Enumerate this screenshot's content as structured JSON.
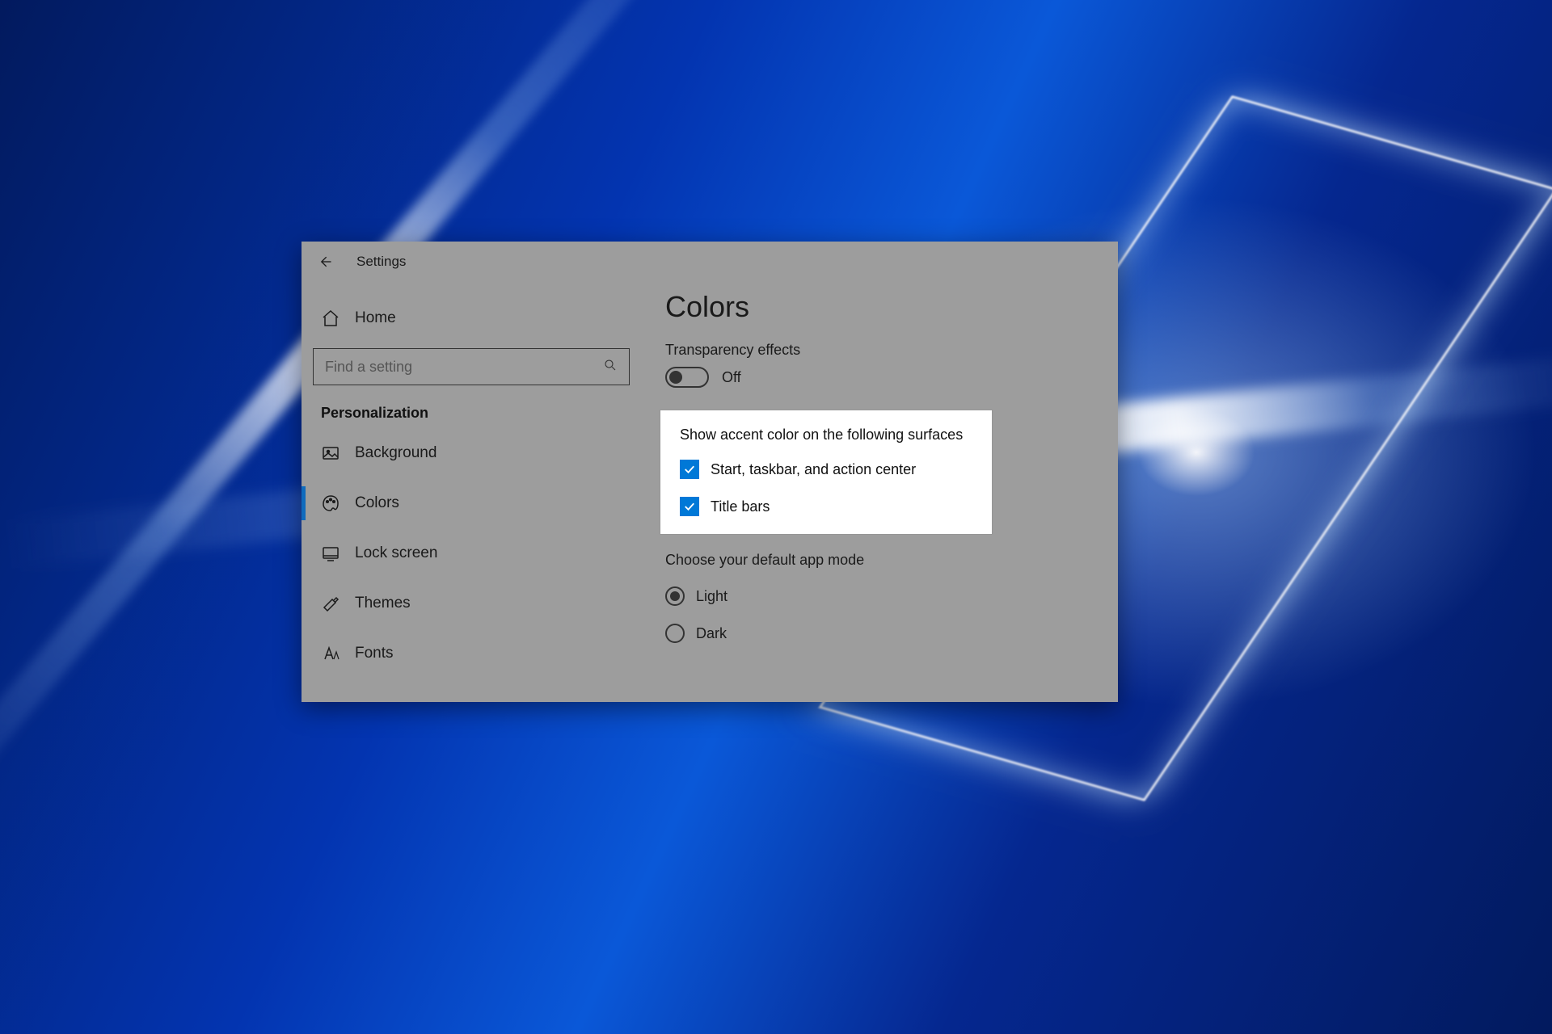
{
  "window": {
    "title": "Settings"
  },
  "sidebar": {
    "home_label": "Home",
    "search_placeholder": "Find a setting",
    "category": "Personalization",
    "items": [
      {
        "label": "Background"
      },
      {
        "label": "Colors"
      },
      {
        "label": "Lock screen"
      },
      {
        "label": "Themes"
      },
      {
        "label": "Fonts"
      }
    ]
  },
  "page": {
    "title": "Colors",
    "transparency_label": "Transparency effects",
    "transparency_state": "Off",
    "accent_section_label": "Show accent color on the following surfaces",
    "accent_options": [
      "Start, taskbar, and action center",
      "Title bars"
    ],
    "app_mode_label": "Choose your default app mode",
    "app_mode_options": [
      "Light",
      "Dark"
    ],
    "app_mode_selected": "Light"
  },
  "colors": {
    "accent": "#0078d7"
  }
}
